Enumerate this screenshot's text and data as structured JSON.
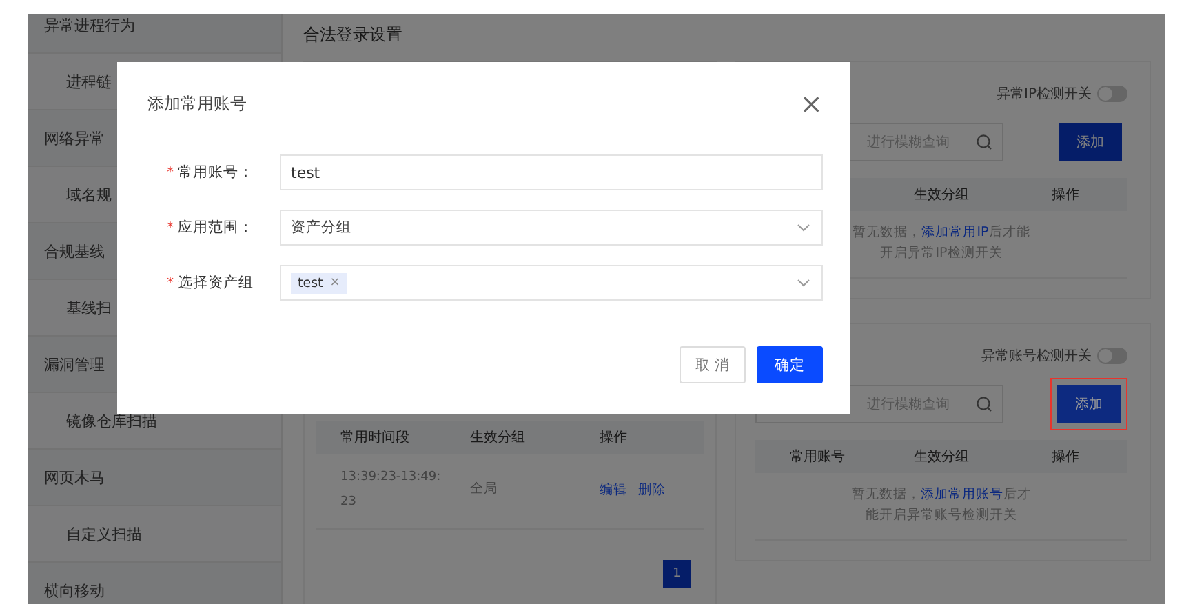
{
  "sidebar": {
    "items": [
      {
        "label": "异常进程行为",
        "children": [
          {
            "label": "进程链"
          }
        ]
      },
      {
        "label": "网络异常",
        "children": [
          {
            "label": "域名规"
          }
        ]
      },
      {
        "label": "合规基线",
        "children": [
          {
            "label": "基线扫"
          }
        ]
      },
      {
        "label": "漏洞管理",
        "children": [
          {
            "label": "镜像仓库扫描"
          }
        ]
      },
      {
        "label": "网页木马",
        "children": [
          {
            "label": "自定义扫描"
          }
        ]
      },
      {
        "label": "横向移动"
      }
    ]
  },
  "page_title": "合法登录设置",
  "time_panel": {
    "columns": [
      "常用时间段",
      "生效分组",
      "操作"
    ],
    "rows": [
      {
        "cells": [
          "13:39:23-13:49:23",
          "全局"
        ],
        "actions": [
          "编辑",
          "删除"
        ]
      }
    ],
    "pages": [
      {
        "label": "1",
        "selected": true
      }
    ]
  },
  "ip_panel": {
    "toggle": {
      "label": "异常IP检测开关",
      "on": false
    },
    "search": {
      "placeholder": "进行模糊查询"
    },
    "add_button": "添加",
    "columns": [
      "生效分组",
      "操作"
    ],
    "empty": {
      "before": "暂无数据，",
      "link": "添加常用IP",
      "after": "后才能开启异常IP检测开关"
    },
    "highlighted": false
  },
  "account_panel": {
    "toggle": {
      "label": "异常账号检测开关",
      "on": false
    },
    "search": {
      "placeholder": "进行模糊查询"
    },
    "add_button": "添加",
    "columns": [
      "常用账号",
      "生效分组",
      "操作"
    ],
    "empty": {
      "before": "暂无数据，",
      "link": "添加常用账号",
      "after": "后才能开启异常账号检测开关"
    },
    "highlighted": true
  },
  "dialog": {
    "title": "添加常用账号",
    "close": "×",
    "fields": [
      {
        "label": "常用账号：",
        "kind": "input",
        "mark": "*",
        "value": "test"
      },
      {
        "label": "应用范围：",
        "kind": "select",
        "mark": "*",
        "value": "资产分组"
      },
      {
        "label": "选择资产组",
        "kind": "tags",
        "mark": "*",
        "tags": [
          {
            "label": "test",
            "remove": "×"
          }
        ]
      }
    ],
    "buttons": [
      {
        "label": "取 消",
        "kind": "secondary"
      },
      {
        "label": "确定",
        "kind": "primary"
      }
    ]
  }
}
